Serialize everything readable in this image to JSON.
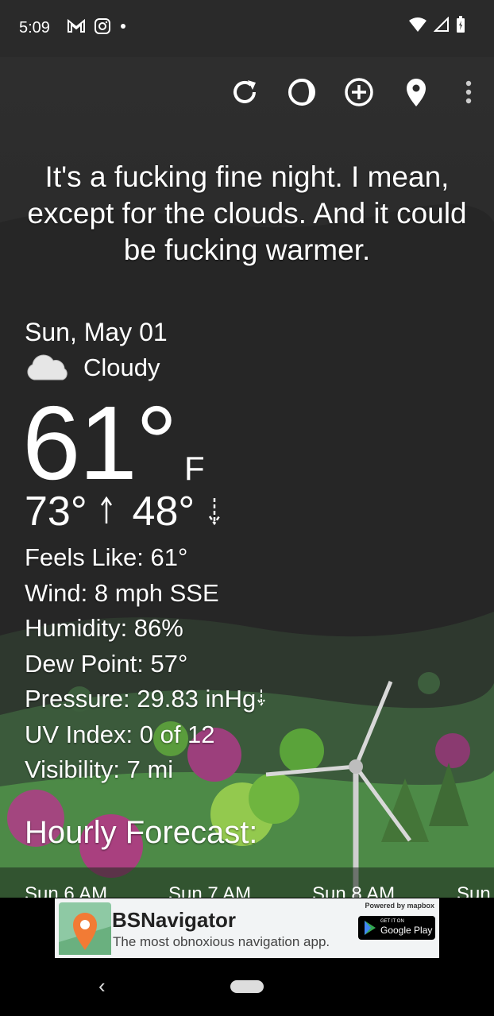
{
  "status": {
    "time": "5:09"
  },
  "toolbar": {
    "icons": [
      "refresh-icon",
      "theme-icon",
      "add-location-icon",
      "location-pin-icon",
      "more-vert-icon"
    ]
  },
  "headline": "It's a fucking fine night. I mean, except for the clouds. And it could be fucking warmer.",
  "current": {
    "date": "Sun, May 01",
    "condition": "Cloudy",
    "temperature": "61°",
    "unit": "F",
    "high": "73°",
    "low": "48°"
  },
  "details": {
    "feels_like": "Feels Like:  61°",
    "wind": "Wind:  8 mph SSE",
    "humidity": "Humidity:  86%",
    "dew_point": "Dew Point:  57°",
    "pressure": "Pressure:  29.83 inHg",
    "uv_index": "UV Index:  0 of 12",
    "visibility": "Visibility:  7 mi"
  },
  "hourly": {
    "title": "Hourly Forecast:",
    "hours": [
      "Sun 6 AM",
      "Sun 7 AM",
      "Sun 8 AM",
      "Sun"
    ]
  },
  "ad": {
    "title": "BSNavigator",
    "subtitle": "The most obnoxious navigation app.",
    "powered": "Powered by mapbox",
    "store_small": "GET IT ON",
    "store_big": "Google Play"
  },
  "colors": {
    "background": "#232323",
    "text": "#ffffff",
    "ad_bg": "#f2f4f5"
  }
}
